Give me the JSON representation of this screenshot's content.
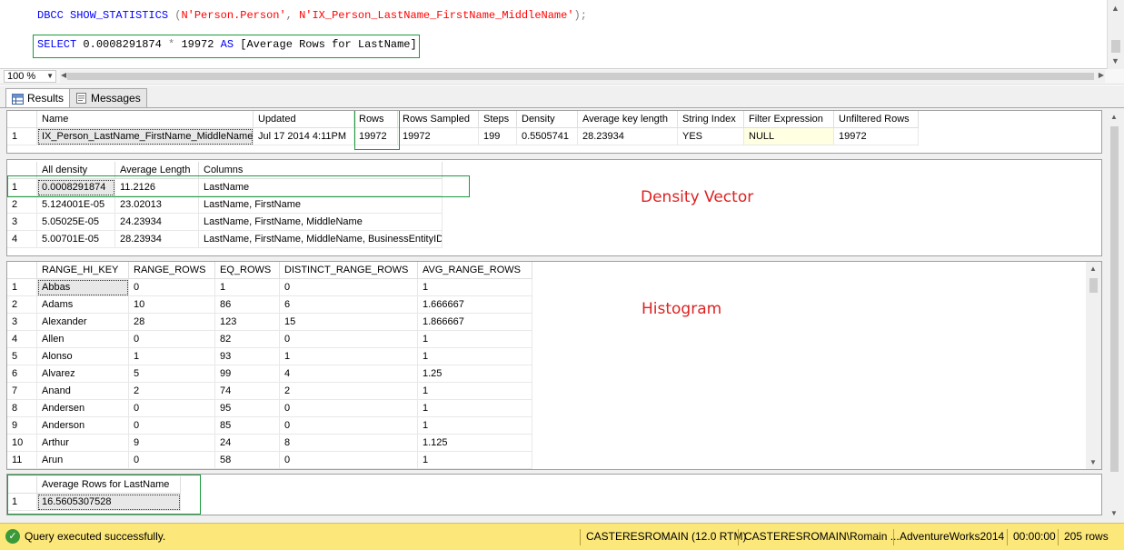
{
  "editor": {
    "line1": {
      "kw1": "DBCC",
      "kw2": "SHOW_STATISTICS",
      "open": " (",
      "str1": "N'Person.Person'",
      "comma": ", ",
      "str2": "N'IX_Person_LastName_FirstName_MiddleName'",
      "close": ");"
    },
    "line2": {
      "kw1": "SELECT",
      "num": " 0.0008291874 ",
      "op": "*",
      "num2": " 19972 ",
      "kw2": "AS",
      "alias": " [Average Rows for LastName]"
    }
  },
  "zoom": {
    "value": "100 %"
  },
  "tabs": [
    {
      "label": "Results",
      "icon": "grid-icon"
    },
    {
      "label": "Messages",
      "icon": "messages-icon"
    }
  ],
  "grid1": {
    "columns": [
      "Name",
      "Updated",
      "Rows",
      "Rows Sampled",
      "Steps",
      "Density",
      "Average key length",
      "String Index",
      "Filter Expression",
      "Unfiltered Rows"
    ],
    "rows": [
      [
        "1",
        "IX_Person_LastName_FirstName_MiddleName",
        "Jul 17 2014  4:11PM",
        "19972",
        "19972",
        "199",
        "0.5505741",
        "28.23934",
        "YES",
        "NULL",
        "19972"
      ]
    ]
  },
  "grid2": {
    "columns": [
      "All density",
      "Average Length",
      "Columns"
    ],
    "rows": [
      [
        "1",
        "0.0008291874",
        "11.2126",
        "LastName"
      ],
      [
        "2",
        "5.124001E-05",
        "23.02013",
        "LastName, FirstName"
      ],
      [
        "3",
        "5.05025E-05",
        "24.23934",
        "LastName, FirstName, MiddleName"
      ],
      [
        "4",
        "5.00701E-05",
        "28.23934",
        "LastName, FirstName, MiddleName, BusinessEntityID"
      ]
    ],
    "annotation": "Density Vector"
  },
  "grid3": {
    "columns": [
      "RANGE_HI_KEY",
      "RANGE_ROWS",
      "EQ_ROWS",
      "DISTINCT_RANGE_ROWS",
      "AVG_RANGE_ROWS"
    ],
    "rows": [
      [
        "1",
        "Abbas",
        "0",
        "1",
        "0",
        "1"
      ],
      [
        "2",
        "Adams",
        "10",
        "86",
        "6",
        "1.666667"
      ],
      [
        "3",
        "Alexander",
        "28",
        "123",
        "15",
        "1.866667"
      ],
      [
        "4",
        "Allen",
        "0",
        "82",
        "0",
        "1"
      ],
      [
        "5",
        "Alonso",
        "1",
        "93",
        "1",
        "1"
      ],
      [
        "6",
        "Alvarez",
        "5",
        "99",
        "4",
        "1.25"
      ],
      [
        "7",
        "Anand",
        "2",
        "74",
        "2",
        "1"
      ],
      [
        "8",
        "Andersen",
        "0",
        "95",
        "0",
        "1"
      ],
      [
        "9",
        "Anderson",
        "0",
        "85",
        "0",
        "1"
      ],
      [
        "10",
        "Arthur",
        "9",
        "24",
        "8",
        "1.125"
      ],
      [
        "11",
        "Arun",
        "0",
        "58",
        "0",
        "1"
      ]
    ],
    "annotation": "Histogram"
  },
  "grid4": {
    "columns": [
      "Average Rows for LastName"
    ],
    "rows": [
      [
        "1",
        "16.5605307528"
      ]
    ]
  },
  "status": {
    "message": "Query executed successfully.",
    "server": "CASTERESROMAIN (12.0 RTM)",
    "user": "CASTERESROMAIN\\Romain ...",
    "database": "AdventureWorks2014",
    "time": "00:00:00",
    "rows": "205 rows"
  },
  "colors": {
    "highlight_box": "#1a9b3a",
    "annotation": "#dd2222",
    "status_bar": "#fbe77a"
  }
}
